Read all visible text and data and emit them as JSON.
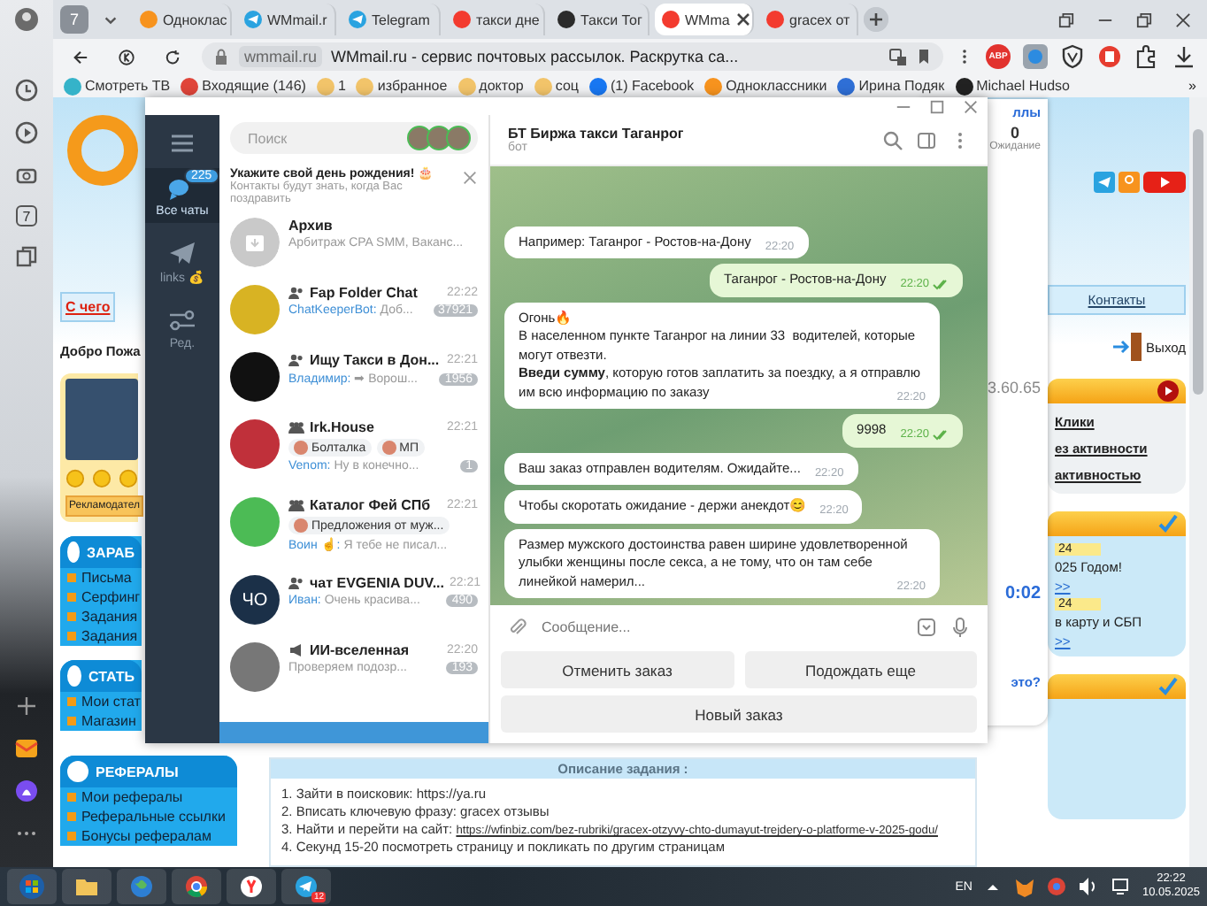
{
  "rail": {
    "tab_count": "7"
  },
  "browser": {
    "tab_count": "7",
    "tabs": [
      {
        "title": "Одноклас",
        "kind": "ok",
        "selected": false
      },
      {
        "title": "WMmail.r",
        "kind": "telegram",
        "selected": false
      },
      {
        "title": "Telegram",
        "kind": "telegram",
        "selected": false
      },
      {
        "title": "такси дне",
        "kind": "yandex",
        "selected": false
      },
      {
        "title": "Такси Тог",
        "kind": "taxi",
        "selected": false
      },
      {
        "title": "WMma",
        "kind": "yandex",
        "selected": true
      },
      {
        "title": "gracex от",
        "kind": "yandex",
        "selected": false
      }
    ],
    "address": {
      "domain": "wmmail.ru",
      "title": "WMmail.ru - сервис почтовых рассылок. Раскрутка са..."
    },
    "extension_badge": "ABP",
    "bookmarks": [
      {
        "label": "Смотреть ТВ",
        "kind": "tv"
      },
      {
        "label": "Входящие (146)",
        "kind": "mail"
      },
      {
        "label": "1",
        "kind": "folder"
      },
      {
        "label": "избранное",
        "kind": "folder"
      },
      {
        "label": "доктор",
        "kind": "folder"
      },
      {
        "label": "соц",
        "kind": "folder"
      },
      {
        "label": "(1) Facebook",
        "kind": "facebook"
      },
      {
        "label": "Одноклассники",
        "kind": "ok"
      },
      {
        "label": "Ирина Подяк",
        "kind": "vk"
      },
      {
        "label": "Michael Hudso",
        "kind": "dark"
      }
    ],
    "bookmarks_more": "»"
  },
  "webpage": {
    "banner_link": "С чего",
    "welcome": "Добро Пожа",
    "advertiser": "Рекламодател",
    "menus": [
      {
        "title": "ЗАРАБ",
        "items": [
          "Письма",
          "Серфинг",
          "Задания",
          "Задания"
        ]
      },
      {
        "title": "СТАТЬ",
        "items": [
          "Мои стат",
          "Магазин"
        ]
      },
      {
        "title": "РЕФЕРАЛЫ",
        "items": [
          "Мои рефералы",
          "Реферальные ссылки",
          "Бонусы рефералам"
        ]
      }
    ],
    "right": {
      "contacts": "Контакты",
      "logout": "Выход",
      "clicks": "Клики",
      "no_activity": "ез активности",
      "with_activity": "активностью",
      "news": [
        {
          "date": "24",
          "text": "025 Годом!",
          "more": ">>"
        },
        {
          "date": "24",
          "text": "в карту и СБП",
          "more": ">>"
        }
      ]
    },
    "task": {
      "title": "Описание задания :",
      "steps": [
        {
          "text": "1. Зайти в поисковик: https://ya.ru"
        },
        {
          "text": "2. Вписать ключевую фразу: gracex отзывы"
        },
        {
          "text": "3. Найти и перейти на сайт:",
          "link": "https://wfinbiz.com/bez-rubriki/gracex-otzyvy-chto-dumayut-trejdery-o-platforme-v-2025-godu/"
        },
        {
          "text": "4. Секунд 15-20 посмотреть страницу и покликать по другим страницам"
        }
      ]
    }
  },
  "popup": {
    "points_label": "ллы",
    "waiting_count": "0",
    "waiting_label": "Ожидание",
    "ip": "3.60.65",
    "timer": "0:02",
    "question": "это?"
  },
  "telegram": {
    "folders": [
      {
        "label": "Все чаты",
        "badge": "225",
        "kind": "chats",
        "selected": true
      },
      {
        "label": "links 💰",
        "kind": "plane",
        "selected": false
      },
      {
        "label": "Ред.",
        "kind": "edit",
        "selected": false
      }
    ],
    "search": {
      "placeholder": "Поиск"
    },
    "birthday": {
      "title": "Укажите свой день рождения! 🎂",
      "text": "Контакты будут знать, когда Вас поздравить"
    },
    "chats": [
      {
        "kind": "archive",
        "name": "Архив",
        "preview": "Арбитраж CPA SMM, Ваканс..."
      },
      {
        "kind": "group",
        "name": "Fap Folder Chat",
        "time": "22:22",
        "sender": "ChatKeeperBot:",
        "preview": "Доб...",
        "badge": "37921"
      },
      {
        "kind": "group",
        "name": "Ищу Такси в Дон...",
        "time": "22:21",
        "sender": "Владимир:",
        "preview": "➡ Ворош...",
        "badge": "1956"
      },
      {
        "kind": "forum",
        "name": "Irk.House",
        "time": "22:21",
        "topics": [
          "Болталка",
          "МП"
        ],
        "sender": "Venom:",
        "preview": "Ну в конечно...",
        "badge": "1"
      },
      {
        "kind": "forum",
        "name": "Каталог Фей СПб",
        "time": "22:21",
        "topics": [
          "Предложения от муж..."
        ],
        "sender": "Воин ☝:",
        "preview": "Я тебе не писал..."
      },
      {
        "kind": "group",
        "name": "чат EVGENIA DUV...",
        "time": "22:21",
        "sender": "Иван:",
        "preview": "Очень красива...",
        "badge": "490",
        "initials": "ЧО"
      },
      {
        "kind": "channel",
        "name": "ИИ-вселенная",
        "time": "22:20",
        "preview": "Проверяем подозр...",
        "badge": "193"
      }
    ],
    "chat": {
      "title": "БТ Биржа такси Таганрог",
      "subtitle": "бот",
      "messages": [
        {
          "out": false,
          "text": "Например: Таганрог - Ростов-на-Дону",
          "time": "22:20"
        },
        {
          "out": true,
          "text": "Таганрог - Ростов-на-Дону",
          "time": "22:20",
          "read": true
        },
        {
          "out": false,
          "text": "Огонь🔥\nВ населенном пункте Таганрог на линии 33  водителей, которые могут отвезти.\n**Введи сумму**, которую готов заплатить за поездку, а я отправлю им всю информацию по заказу",
          "time": "22:20"
        },
        {
          "out": true,
          "text": "9998",
          "time": "22:20",
          "read": true
        },
        {
          "out": false,
          "text": "Ваш заказ отправлен водителям. Ожидайте...",
          "time": "22:20"
        },
        {
          "out": false,
          "text": "Чтобы скоротать ожидание - держи анекдот😊",
          "time": "22:20"
        },
        {
          "out": false,
          "text": "Размер мужского достоинства равен ширине удовлетворенной улыбки женщины после секса, а не тому, что он там себе линейкой намерил...",
          "time": "22:20"
        }
      ],
      "input_placeholder": "Сообщение...",
      "keyboard": [
        [
          "Отменить заказ",
          "Подождать еще"
        ],
        [
          "Новый заказ"
        ]
      ]
    }
  },
  "taskbar": {
    "apps": [
      {
        "kind": "start"
      },
      {
        "kind": "explorer"
      },
      {
        "kind": "globe"
      },
      {
        "kind": "chrome"
      },
      {
        "kind": "yandex"
      },
      {
        "kind": "telegram",
        "badge": "12"
      }
    ],
    "language": "EN",
    "time": "22:22",
    "date": "10.05.2025"
  }
}
